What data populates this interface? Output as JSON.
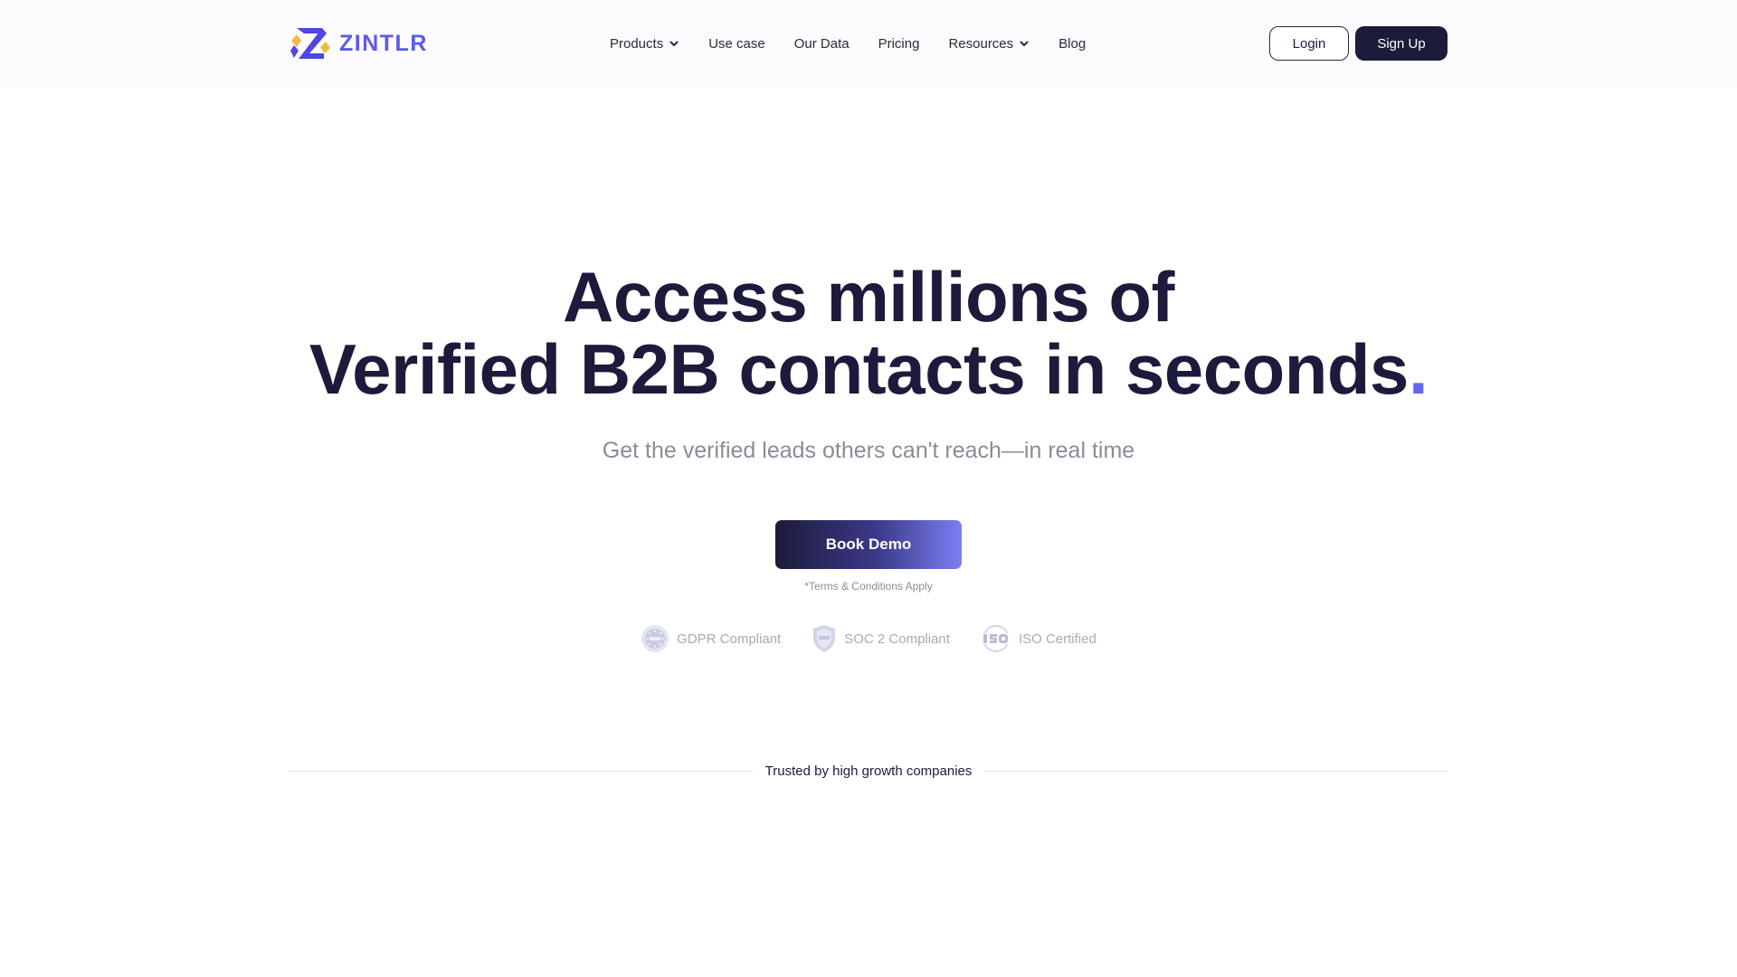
{
  "brand": {
    "name": "ZINTLR",
    "accent_color": "#5b5be8",
    "dark_color": "#1c1b3b"
  },
  "nav": {
    "items": [
      {
        "label": "Products",
        "has_dropdown": true
      },
      {
        "label": "Use case",
        "has_dropdown": false
      },
      {
        "label": "Our Data",
        "has_dropdown": false
      },
      {
        "label": "Pricing",
        "has_dropdown": false
      },
      {
        "label": "Resources",
        "has_dropdown": true
      },
      {
        "label": "Blog",
        "has_dropdown": false
      }
    ],
    "login_label": "Login",
    "signup_label": "Sign Up"
  },
  "hero": {
    "title_line1": "Access millions of",
    "title_line2": "Verified B2B contacts in seconds",
    "title_dot": ".",
    "dot_color": "#6366f1",
    "subtitle": "Get the verified leads others can't reach—in real time",
    "cta_label": "Book Demo",
    "terms": "*Terms & Conditions Apply"
  },
  "badges": [
    {
      "icon": "gdpr-icon",
      "label": "GDPR Compliant"
    },
    {
      "icon": "soc2-shield-icon",
      "label": "SOC 2 Compliant"
    },
    {
      "icon": "iso-icon",
      "label": "ISO Certified"
    }
  ],
  "trusted": {
    "label": "Trusted by high growth companies"
  }
}
